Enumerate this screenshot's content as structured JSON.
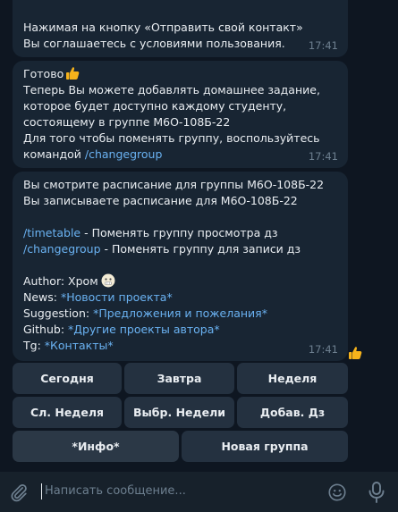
{
  "messages": [
    {
      "lines": [
        "Нажимая на кнопку «Отправить свой контакт»",
        "Вы соглашаетесь с условиями пользования."
      ],
      "time": "17:41"
    },
    {
      "title": "Готово",
      "lines": [
        "Теперь Вы можете добавлять домашнее задание,",
        "которое будет доступно каждому студенту,",
        "состоящему в группе М6О-108Б-22",
        "Для того чтобы поменять группу, воспользуйтесь"
      ],
      "last_prefix": "командой ",
      "last_link": "/changegroup",
      "time": "17:41"
    },
    {
      "lines": [
        "Вы смотрите расписание для группы М6О-108Б-22",
        "Вы записываете расписание для М6О-108Б-22"
      ],
      "cmd1_link": "/timetable",
      "cmd1_text": " - Поменять группу просмотра дз",
      "cmd2_link": "/changegroup",
      "cmd2_text": " - Поменять группу для записи дз",
      "author_label": "Author: Хром",
      "news_label": "News: ",
      "news_link": "*Новости проекта*",
      "suggestion_label": "Suggestion: ",
      "suggestion_link": "*Предложения и пожелания*",
      "github_label": "Github: ",
      "github_link": "*Другие проекты автора*",
      "tg_label": "Tg: ",
      "tg_link": "*Контакты*",
      "time": "17:41"
    }
  ],
  "keyboard": {
    "row1": [
      "Сегодня",
      "Завтра",
      "Неделя"
    ],
    "row2": [
      "Сл. Неделя",
      "Выбр. Недели",
      "Добав. Дз"
    ],
    "row3": [
      "*Инфо*",
      "Новая группа"
    ]
  },
  "input": {
    "placeholder": "Написать сообщение..."
  },
  "icons": {
    "attach": "paperclip-icon",
    "emoji": "smile-icon",
    "mic": "microphone-icon",
    "reaction": "thumbs-up-icon"
  },
  "colors": {
    "background": "#0e1621",
    "bubble": "#182533",
    "link": "#6ab2f2",
    "button": "#243140",
    "input_bar": "#17212b"
  }
}
